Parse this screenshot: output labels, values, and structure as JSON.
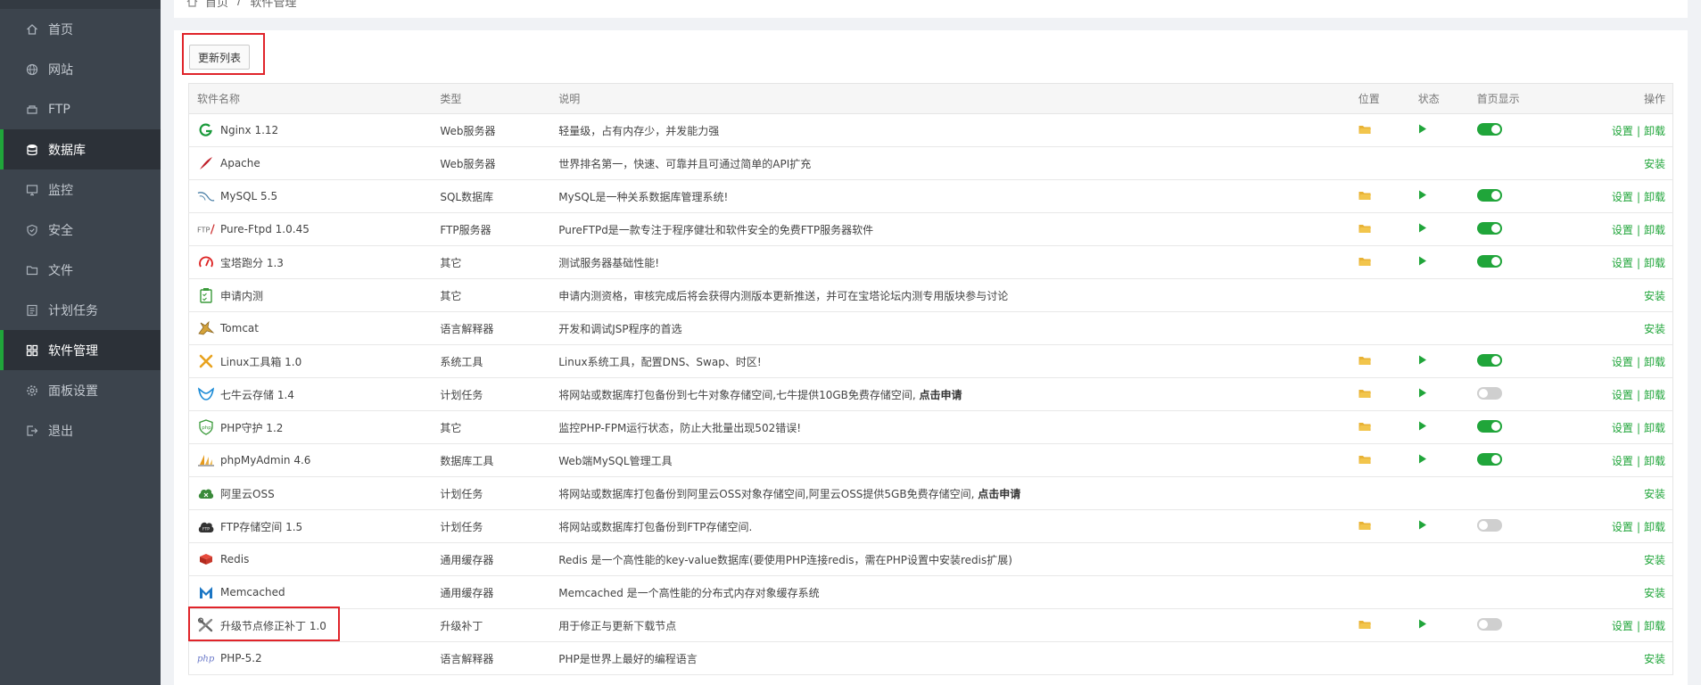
{
  "sidebar": {
    "items": [
      {
        "label": "首页",
        "icon": "home-icon"
      },
      {
        "label": "网站",
        "icon": "globe-icon"
      },
      {
        "label": "FTP",
        "icon": "ftp-icon"
      },
      {
        "label": "数据库",
        "icon": "database-icon",
        "active": true
      },
      {
        "label": "监控",
        "icon": "monitor-icon"
      },
      {
        "label": "安全",
        "icon": "shield-icon"
      },
      {
        "label": "文件",
        "icon": "folder-icon"
      },
      {
        "label": "计划任务",
        "icon": "list-icon"
      },
      {
        "label": "软件管理",
        "icon": "grid-icon",
        "active": true
      },
      {
        "label": "面板设置",
        "icon": "gear-icon"
      },
      {
        "label": "退出",
        "icon": "logout-icon"
      }
    ]
  },
  "breadcrumb": {
    "home": "首页",
    "sep": "/",
    "current": "软件管理"
  },
  "toolbar": {
    "update_label": "更新列表"
  },
  "table": {
    "headers": {
      "name": "软件名称",
      "type": "类型",
      "desc": "说明",
      "location": "位置",
      "status": "状态",
      "homepage": "首页显示",
      "op": "操作"
    },
    "op_labels": {
      "settings": "设置",
      "sep": "|",
      "uninstall": "卸载",
      "install": "安装"
    },
    "rows": [
      {
        "name": "Nginx 1.12",
        "type": "Web服务器",
        "desc": "轻量级，占有内存少，并发能力强",
        "installed": true,
        "home": true,
        "icon": "nginx-icon"
      },
      {
        "name": "Apache",
        "type": "Web服务器",
        "desc": "世界排名第一，快速、可靠并且可通过简单的API扩充",
        "installed": false,
        "icon": "apache-icon"
      },
      {
        "name": "MySQL 5.5",
        "type": "SQL数据库",
        "desc": "MySQL是一种关系数据库管理系统!",
        "installed": true,
        "home": true,
        "icon": "mysql-icon"
      },
      {
        "name": "Pure-Ftpd 1.0.45",
        "type": "FTP服务器",
        "desc": "PureFTPd是一款专注于程序健壮和软件安全的免费FTP服务器软件",
        "installed": true,
        "home": true,
        "icon": "ftp-text-icon"
      },
      {
        "name": "宝塔跑分 1.3",
        "type": "其它",
        "desc": "测试服务器基础性能!",
        "installed": true,
        "home": true,
        "icon": "gauge-icon"
      },
      {
        "name": "申请内测",
        "type": "其它",
        "desc": "申请内测资格，审核完成后将会获得内测版本更新推送，并可在宝塔论坛内测专用版块参与讨论",
        "installed": false,
        "icon": "clipboard-icon"
      },
      {
        "name": "Tomcat",
        "type": "语言解释器",
        "desc": "开发和调试JSP程序的首选",
        "installed": false,
        "icon": "tomcat-icon"
      },
      {
        "name": "Linux工具箱 1.0",
        "type": "系统工具",
        "desc": "Linux系统工具，配置DNS、Swap、时区!",
        "installed": true,
        "home": true,
        "icon": "tools-icon"
      },
      {
        "name": "七牛云存储 1.4",
        "type": "计划任务",
        "desc": "将网站或数据库打包备份到七牛对象存储空间,七牛提供10GB免费存储空间, ",
        "link": "点击申请",
        "installed": true,
        "home": false,
        "icon": "qiniu-icon"
      },
      {
        "name": "PHP守护 1.2",
        "type": "其它",
        "desc": "监控PHP-FPM运行状态，防止大批量出现502错误!",
        "installed": true,
        "home": true,
        "icon": "php-shield-icon"
      },
      {
        "name": "phpMyAdmin 4.6",
        "type": "数据库工具",
        "desc": "Web端MySQL管理工具",
        "installed": true,
        "home": true,
        "icon": "sailboat-icon"
      },
      {
        "name": "阿里云OSS",
        "type": "计划任务",
        "desc": "将网站或数据库打包备份到阿里云OSS对象存储空间,阿里云OSS提供5GB免费存储空间, ",
        "link": "点击申请",
        "installed": false,
        "icon": "aliyun-icon"
      },
      {
        "name": "FTP存储空间 1.5",
        "type": "计划任务",
        "desc": "将网站或数据库打包备份到FTP存储空间.",
        "installed": true,
        "home": false,
        "icon": "ftp-cloud-icon"
      },
      {
        "name": "Redis",
        "type": "通用缓存器",
        "desc": "Redis 是一个高性能的key-value数据库(要使用PHP连接redis，需在PHP设置中安装redis扩展)",
        "installed": false,
        "icon": "redis-icon"
      },
      {
        "name": "Memcached",
        "type": "通用缓存器",
        "desc": "Memcached 是一个高性能的分布式内存对象缓存系统",
        "installed": false,
        "icon": "memcached-icon"
      },
      {
        "name": "升级节点修正补丁 1.0",
        "type": "升级补丁",
        "desc": "用于修正与更新下载节点",
        "installed": true,
        "home": false,
        "icon": "wrench-icon"
      },
      {
        "name": "PHP-5.2",
        "type": "语言解释器",
        "desc": "PHP是世界上最好的编程语言",
        "installed": false,
        "icon": "php-icon"
      }
    ]
  },
  "colors": {
    "accent": "#20a53a",
    "highlight": "#e0242a",
    "folder": "#e8b234",
    "sidebar": "#3c444d"
  }
}
